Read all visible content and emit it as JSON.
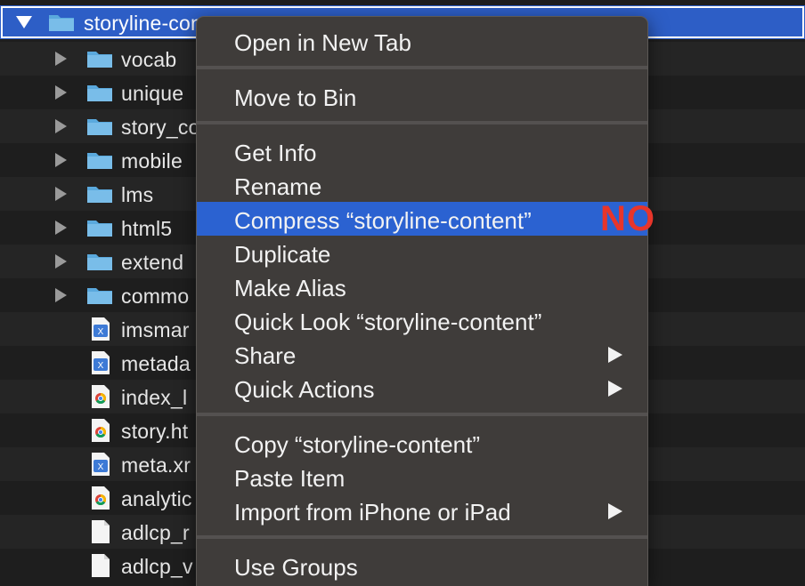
{
  "finder": {
    "selected_row": {
      "name": "storyline-content",
      "icon": "folder-icon",
      "expanded": true
    },
    "rows": [
      {
        "name": "vocab",
        "icon": "folder-icon"
      },
      {
        "name": "unique",
        "icon": "folder-icon"
      },
      {
        "name": "story_co",
        "icon": "folder-icon"
      },
      {
        "name": "mobile",
        "icon": "folder-icon"
      },
      {
        "name": "lms",
        "icon": "folder-icon"
      },
      {
        "name": "html5",
        "icon": "folder-icon"
      },
      {
        "name": "extend",
        "icon": "folder-icon"
      },
      {
        "name": "commo",
        "icon": "folder-icon"
      },
      {
        "name": "imsmar",
        "icon": "xml-file-icon"
      },
      {
        "name": "metada",
        "icon": "xml-file-icon"
      },
      {
        "name": "index_l",
        "icon": "chrome-html-file-icon"
      },
      {
        "name": "story.ht",
        "icon": "chrome-html-file-icon"
      },
      {
        "name": "meta.xr",
        "icon": "xml-file-icon"
      },
      {
        "name": "analytic",
        "icon": "chrome-html-file-icon"
      },
      {
        "name": "adlcp_r",
        "icon": "blank-file-icon"
      },
      {
        "name": "adlcp_v",
        "icon": "blank-file-icon"
      }
    ]
  },
  "context_menu": {
    "open_in_new_tab": "Open in New Tab",
    "move_to_bin": "Move to Bin",
    "get_info": "Get Info",
    "rename": "Rename",
    "compress": "Compress “storyline-content”",
    "duplicate": "Duplicate",
    "make_alias": "Make Alias",
    "quick_look": "Quick Look “storyline-content”",
    "share": "Share",
    "quick_actions": "Quick Actions",
    "copy": "Copy “storyline-content”",
    "paste_item": "Paste Item",
    "import_from_iphone": "Import from iPhone or iPad",
    "use_groups": "Use Groups"
  },
  "annotation": {
    "text": "NO",
    "color": "#e8352a"
  },
  "colors": {
    "selection": "#2d5ec6",
    "menu_background": "#3f3c3a",
    "menu_highlight": "#2b62d1",
    "folder": "#5aa9dd"
  }
}
